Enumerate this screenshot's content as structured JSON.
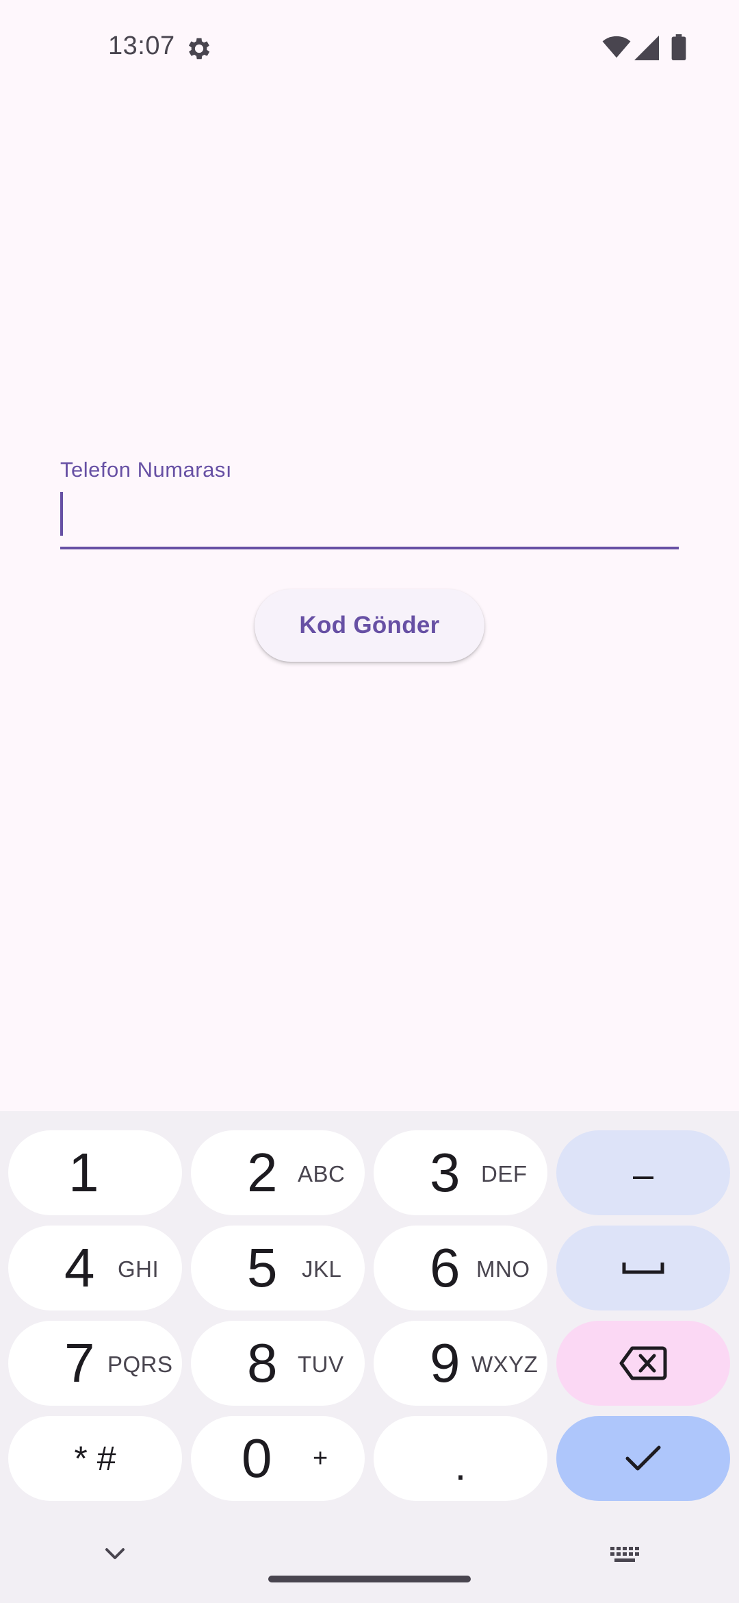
{
  "status_bar": {
    "time": "13:07",
    "icons": [
      "gear-icon",
      "wifi-icon",
      "signal-icon",
      "battery-icon"
    ]
  },
  "form": {
    "phone_label": "Telefon Numarası",
    "phone_value": "",
    "send_button_label": "Kod Gönder"
  },
  "keyboard": {
    "keys": [
      {
        "digit": "1",
        "letters": ""
      },
      {
        "digit": "2",
        "letters": "ABC"
      },
      {
        "digit": "3",
        "letters": "DEF"
      },
      {
        "digit": "4",
        "letters": "GHI"
      },
      {
        "digit": "5",
        "letters": "JKL"
      },
      {
        "digit": "6",
        "letters": "MNO"
      },
      {
        "digit": "7",
        "letters": "PQRS"
      },
      {
        "digit": "8",
        "letters": "TUV"
      },
      {
        "digit": "9",
        "letters": "WXYZ"
      },
      {
        "digit": "0",
        "letters": "+"
      }
    ],
    "star_hash": "* #",
    "period": ".",
    "dash": "–"
  },
  "colors": {
    "accent": "#6750a4",
    "background": "#fef7fc",
    "keyboard_bg": "#f2eff4",
    "enter_key": "#aec6fb",
    "backspace_key": "#fbd8f4",
    "function_key": "#dde3f8"
  }
}
